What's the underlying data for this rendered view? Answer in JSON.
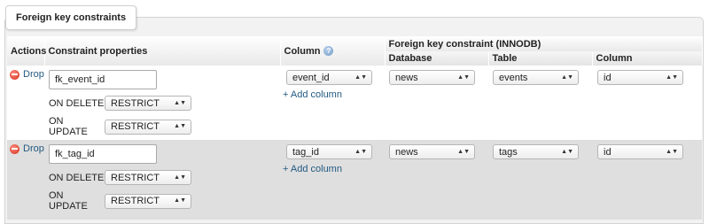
{
  "panel": {
    "legend": "Foreign key constraints"
  },
  "headers": {
    "actions": "Actions",
    "constraint_properties": "Constraint properties",
    "column": "Column",
    "foreign_key_group": "Foreign key constraint (INNODB)",
    "database": "Database",
    "table": "Table",
    "foreign_column": "Column"
  },
  "labels": {
    "drop": "Drop",
    "on_delete": "ON DELETE",
    "on_update": "ON UPDATE",
    "add_column": "+ Add column"
  },
  "rows": [
    {
      "constraint_name": "fk_event_id",
      "on_delete": "RESTRICT",
      "on_update": "RESTRICT",
      "column": "event_id",
      "database": "news",
      "table": "events",
      "foreign_column": "id"
    },
    {
      "constraint_name": "fk_tag_id",
      "on_delete": "RESTRICT",
      "on_update": "RESTRICT",
      "column": "tag_id",
      "database": "news",
      "table": "tags",
      "foreign_column": "id"
    }
  ],
  "icons": {
    "drop": "drop-icon",
    "help": "help-icon",
    "select_arrows": "select-arrows-icon"
  },
  "colors": {
    "link": "#235a81",
    "row_alt": "#dfdfdf",
    "drop_icon": "#d2301f"
  }
}
